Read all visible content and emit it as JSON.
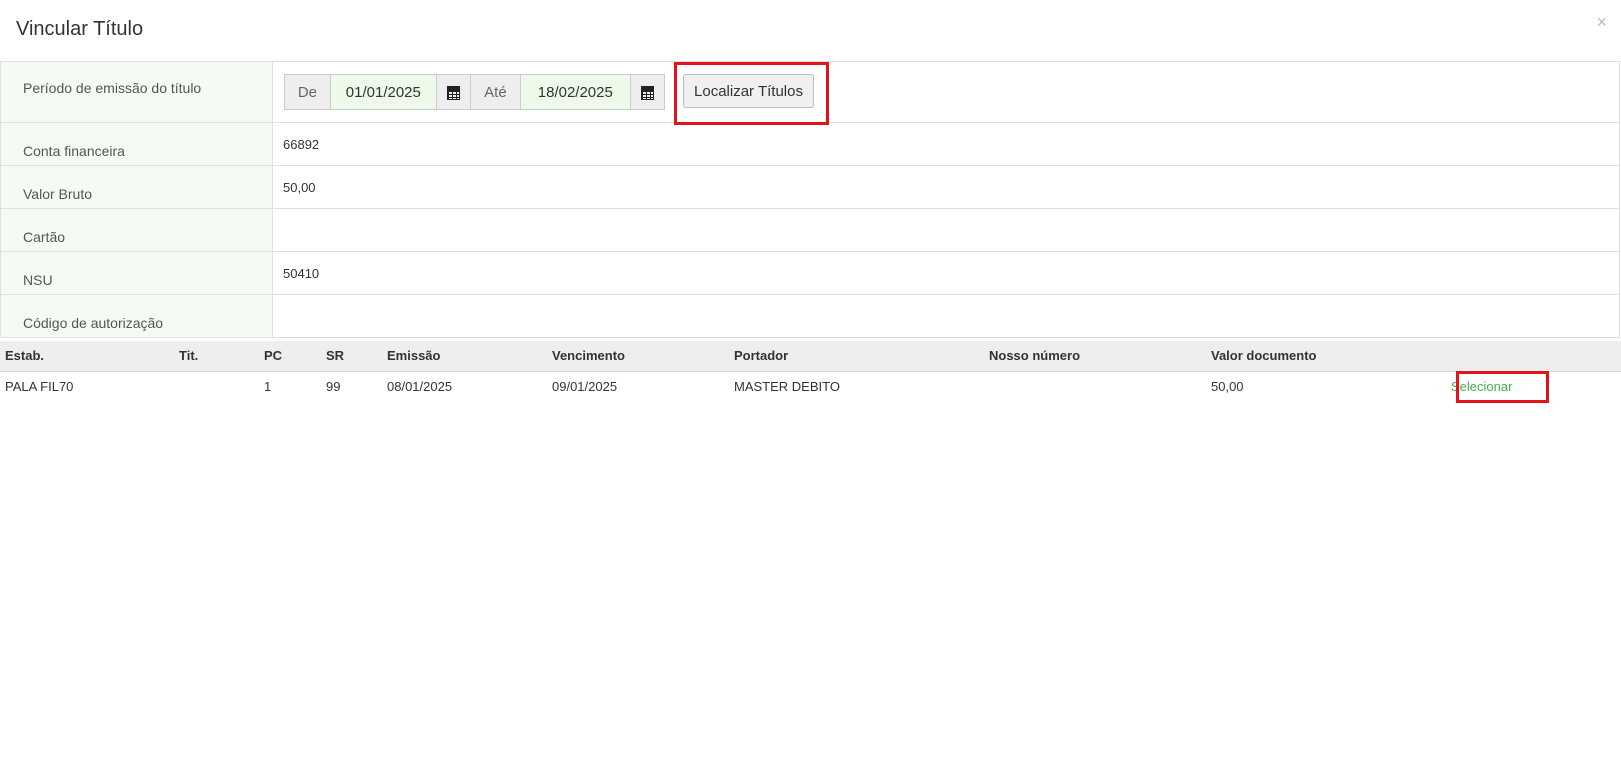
{
  "modal": {
    "title": "Vincular Título",
    "close_label": "×"
  },
  "form": {
    "period": {
      "label": "Período de emissão do título",
      "from_label": "De",
      "from_value": "01/01/2025",
      "to_label": "Até",
      "to_value": "18/02/2025",
      "calendar_icon": "calendar-icon",
      "search_button": "Localizar Títulos"
    },
    "fields": [
      {
        "label": "Conta financeira",
        "value": "66892"
      },
      {
        "label": "Valor Bruto",
        "value": "50,00"
      },
      {
        "label": "Cartão",
        "value": ""
      },
      {
        "label": "NSU",
        "value": "50410"
      },
      {
        "label": "Código de autorização",
        "value": ""
      }
    ]
  },
  "results": {
    "columns": [
      "Estab.",
      "Tit.",
      "PC",
      "SR",
      "Emissão",
      "Vencimento",
      "Portador",
      "Nosso número",
      "Valor documento",
      ""
    ],
    "rows": [
      {
        "estab": "PALA FIL70",
        "tit": "",
        "pc": "1",
        "sr": "99",
        "emissao": "08/01/2025",
        "vencimento": "09/01/2025",
        "portador": "MASTER DEBITO",
        "nosso_numero": "",
        "valor_documento": "50,00",
        "action": "Selecionar"
      }
    ]
  },
  "colors": {
    "highlight": "#e1141c",
    "label_bg": "#f5fbf4",
    "date_bg": "#eef9ea",
    "link": "#4cae4c"
  }
}
